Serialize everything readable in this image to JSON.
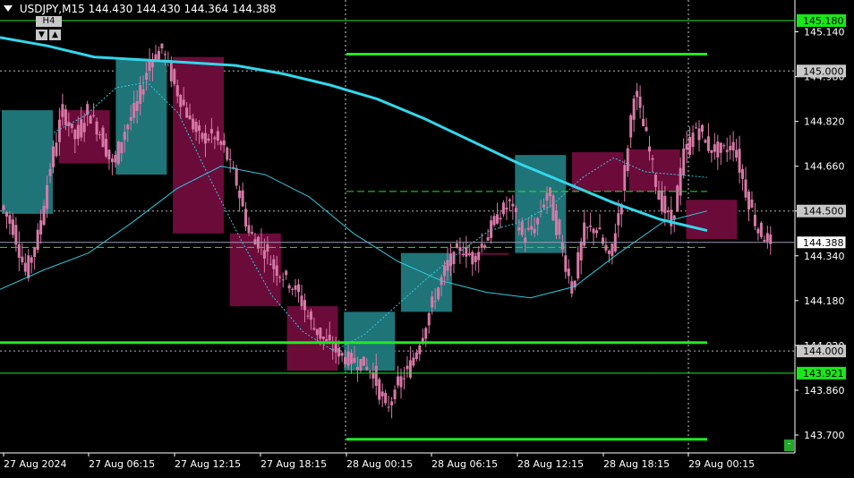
{
  "header": {
    "symbol": "USDJPY,M15",
    "open": "144.430",
    "high": "144.430",
    "low": "144.364",
    "close": "144.388",
    "timeframe_button": "H4",
    "scroll_down": "▼",
    "scroll_up": "▲",
    "corner_button": "-"
  },
  "colors": {
    "background": "#000000",
    "bull_candle": "#d779a6",
    "bear_candle": "#d779a6",
    "bull_box": "#1f7478",
    "bear_box": "#6b0b3a",
    "ma_thick": "#33d6ea",
    "ma_thin": "#2fc9dc",
    "level_line": "#22e822",
    "price_tag": "#c8c8c8",
    "alert_tag": "#18e818"
  },
  "chart_data": {
    "type": "candlestick",
    "symbol": "USDJPY",
    "timeframe": "M15",
    "ylim": [
      143.66,
      145.26
    ],
    "y_ticks": [
      "145.140",
      "144.980",
      "144.820",
      "144.660",
      "144.500",
      "144.340",
      "144.180",
      "144.020",
      "143.860",
      "143.700"
    ],
    "x_ticks": [
      "27 Aug 2024",
      "27 Aug 06:15",
      "27 Aug 12:15",
      "27 Aug 18:15",
      "28 Aug 00:15",
      "28 Aug 06:15",
      "28 Aug 12:15",
      "28 Aug 18:15",
      "29 Aug 00:15"
    ],
    "price_tags": [
      {
        "value": "145.180",
        "style": "alert"
      },
      {
        "value": "145.000",
        "style": "normal"
      },
      {
        "value": "144.500",
        "style": "normal"
      },
      {
        "value": "144.388",
        "style": "current"
      },
      {
        "value": "144.000",
        "style": "normal"
      },
      {
        "value": "143.921",
        "style": "alert"
      }
    ],
    "horizontal_levels": [
      {
        "price": 145.18,
        "x_from": "start",
        "style": "thin"
      },
      {
        "price": 145.06,
        "x_from": "28 Aug 00:15",
        "style": "thick"
      },
      {
        "price": 144.57,
        "x_from": "28 Aug 00:15",
        "style": "dashed"
      },
      {
        "price": 144.37,
        "x_from": "start",
        "style": "dashed"
      },
      {
        "price": 144.03,
        "x_from": "start",
        "style": "thick"
      },
      {
        "price": 143.921,
        "x_from": "start",
        "style": "thin"
      },
      {
        "price": 143.685,
        "x_from": "28 Aug 00:15",
        "style": "thick"
      }
    ],
    "h4_boxes": [
      {
        "open": 144.86,
        "close": 144.49,
        "type": "bull"
      },
      {
        "open": 144.86,
        "close": 144.67,
        "type": "bear"
      },
      {
        "open": 144.63,
        "close": 145.04,
        "type": "bull"
      },
      {
        "open": 145.05,
        "close": 144.42,
        "type": "bear"
      },
      {
        "open": 144.42,
        "close": 144.16,
        "type": "bear"
      },
      {
        "open": 144.16,
        "close": 143.93,
        "type": "bear"
      },
      {
        "open": 143.93,
        "close": 144.14,
        "type": "bull"
      },
      {
        "open": 144.14,
        "close": 144.35,
        "type": "bull"
      },
      {
        "open": 144.35,
        "close": 144.35,
        "type": "bear"
      },
      {
        "open": 144.35,
        "close": 144.7,
        "type": "bull"
      },
      {
        "open": 144.71,
        "close": 144.57,
        "type": "bear"
      },
      {
        "open": 144.72,
        "close": 144.57,
        "type": "bear"
      },
      {
        "open": 144.54,
        "close": 144.4,
        "type": "bear"
      }
    ],
    "price_path": [
      144.52,
      144.44,
      144.28,
      144.41,
      144.66,
      144.86,
      144.76,
      144.86,
      144.78,
      144.66,
      144.79,
      144.88,
      145.04,
      145.08,
      144.95,
      144.85,
      144.76,
      144.77,
      144.72,
      144.6,
      144.42,
      144.38,
      144.3,
      144.26,
      144.2,
      144.1,
      144.04,
      144.0,
      143.97,
      143.96,
      143.92,
      143.79,
      143.88,
      143.95,
      144.07,
      144.2,
      144.31,
      144.37,
      144.33,
      144.4,
      144.48,
      144.53,
      144.41,
      144.44,
      144.57,
      144.4,
      144.22,
      144.43,
      144.44,
      144.32,
      144.55,
      144.93,
      144.76,
      144.55,
      144.45,
      144.7,
      144.8,
      144.73,
      144.71,
      144.74,
      144.57,
      144.43,
      144.39
    ],
    "ma_slow": [
      145.12,
      145.09,
      145.05,
      145.04,
      145.03,
      145.02,
      144.99,
      144.95,
      144.9,
      144.83,
      144.75,
      144.67,
      144.6,
      144.53,
      144.47,
      144.43
    ],
    "ma_fast": [
      144.22,
      144.29,
      144.35,
      144.46,
      144.58,
      144.66,
      144.63,
      144.55,
      144.42,
      144.32,
      144.25,
      144.21,
      144.19,
      144.23,
      144.35,
      144.46,
      144.5
    ],
    "ma_dotted": [
      144.78,
      144.84,
      144.94,
      144.96,
      144.85,
      144.62,
      144.4,
      144.2,
      144.07,
      144.0,
      144.06,
      144.16,
      144.26,
      144.35,
      144.43,
      144.46,
      144.52,
      144.62,
      144.69,
      144.64,
      144.63,
      144.62
    ]
  }
}
